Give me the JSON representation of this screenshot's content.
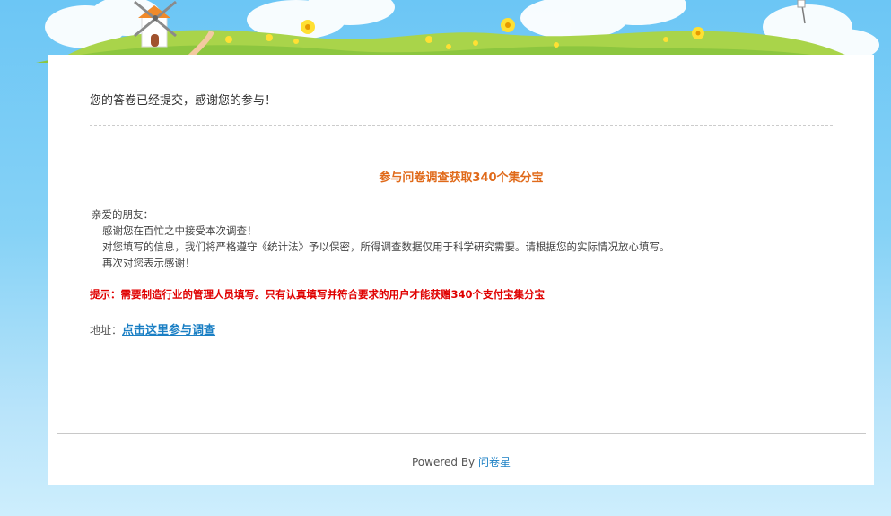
{
  "thanks_message": "您的答卷已经提交，感谢您的参与！",
  "promo_title": "参与问卷调查获取340个集分宝",
  "letter": {
    "greeting": "亲爱的朋友：",
    "lines": [
      "感谢您在百忙之中接受本次调查！",
      "对您填写的信息，我们将严格遵守《统计法》予以保密，所得调查数据仅用于科学研究需要。请根据您的实际情况放心填写。",
      "再次对您表示感谢！"
    ]
  },
  "hint": "提示：需要制造行业的管理人员填写。只有认真填写并符合要求的用户才能获赠340个支付宝集分宝",
  "address": {
    "label": "地址：",
    "link_text": "点击这里参与调查"
  },
  "footer": {
    "powered_by": "Powered By",
    "brand": "问卷星"
  },
  "colors": {
    "sky": "#6cc6f5",
    "promo": "#e06a1a",
    "hint": "#e00000",
    "link": "#1a7fc4"
  }
}
